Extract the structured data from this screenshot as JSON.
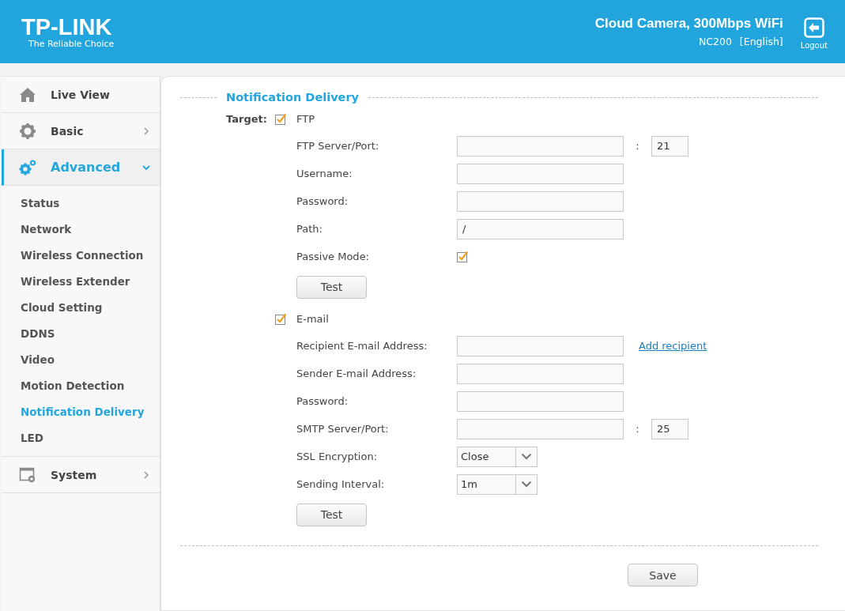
{
  "header": {
    "logo": "TP-LINK",
    "tagline": "The Reliable Choice",
    "product": "Cloud Camera, 300Mbps WiFi",
    "model": "NC200",
    "language": "[English]",
    "logout": "Logout"
  },
  "sidebar": {
    "items": [
      {
        "label": "Live View",
        "selected": false
      },
      {
        "label": "Basic",
        "selected": false,
        "expanded": false
      },
      {
        "label": "Advanced",
        "selected": true,
        "expanded": true,
        "children": [
          {
            "label": "Status",
            "selected": false
          },
          {
            "label": "Network",
            "selected": false
          },
          {
            "label": "Wireless Connection",
            "selected": false
          },
          {
            "label": "Wireless Extender",
            "selected": false
          },
          {
            "label": "Cloud Setting",
            "selected": false
          },
          {
            "label": "DDNS",
            "selected": false
          },
          {
            "label": "Video",
            "selected": false
          },
          {
            "label": "Motion Detection",
            "selected": false
          },
          {
            "label": "Notification Delivery",
            "selected": true
          },
          {
            "label": "LED",
            "selected": false
          }
        ]
      },
      {
        "label": "System",
        "selected": false,
        "expanded": false
      }
    ]
  },
  "form": {
    "title": "Notification Delivery",
    "target_label": "Target:",
    "targets": [
      {
        "label": "FTP",
        "checked": true,
        "fields": [
          {
            "kind": "text",
            "label": "FTP Server/Port:",
            "separator": ":",
            "port": "21"
          },
          {
            "kind": "text",
            "label": "Username:"
          },
          {
            "kind": "text",
            "label": "Password:"
          },
          {
            "kind": "text",
            "label": "Path:",
            "value": "/"
          },
          {
            "kind": "checkbox",
            "label": "Passive Mode:",
            "checked": true
          }
        ],
        "test_button": "Test"
      },
      {
        "label": "E-mail",
        "checked": true,
        "fields": [
          {
            "kind": "text",
            "label": "Recipient E-mail Address:",
            "link": "Add recipient"
          },
          {
            "kind": "text",
            "label": "Sender E-mail Address:"
          },
          {
            "kind": "text",
            "label": "Password:"
          },
          {
            "kind": "text",
            "label": "SMTP Server/Port:",
            "separator": ":",
            "port": "25"
          },
          {
            "kind": "select",
            "label": "SSL Encryption:",
            "value": "Close"
          },
          {
            "kind": "select",
            "label": "Sending Interval:",
            "value": "1m"
          }
        ],
        "test_button": "Test"
      }
    ],
    "save_button": "Save"
  }
}
